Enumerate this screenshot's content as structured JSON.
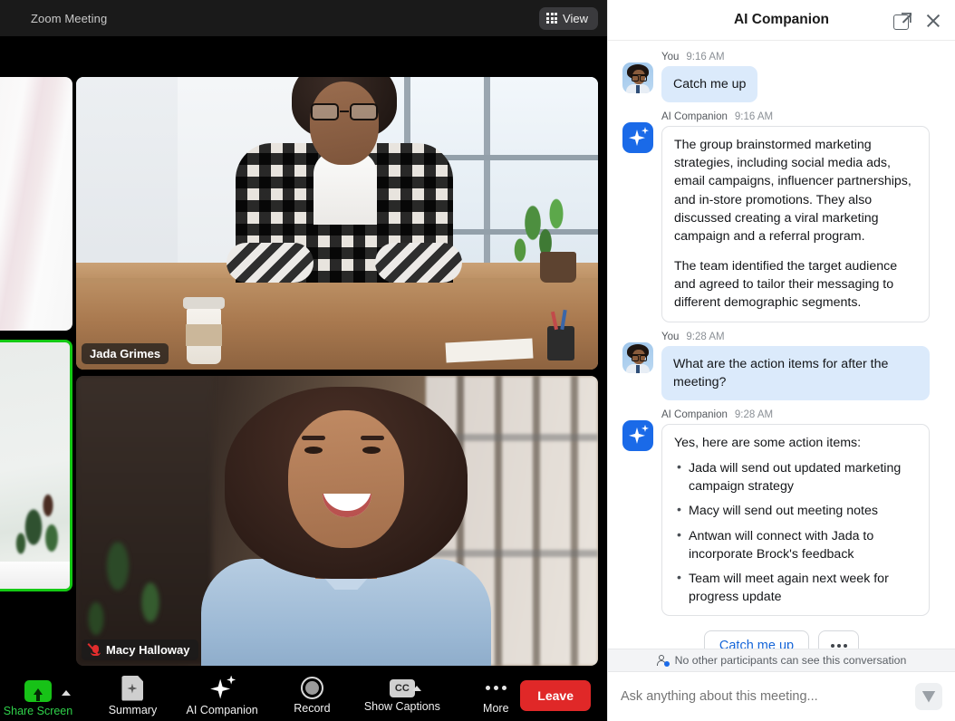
{
  "meeting": {
    "title": "Zoom Meeting",
    "view_button": {
      "label": "View",
      "icon": "grid-icon"
    },
    "participants": [
      {
        "name": "Jada Grimes",
        "muted": false
      },
      {
        "name": "Macy Halloway",
        "muted": true
      }
    ],
    "toolbar": [
      {
        "label": "Share Screen",
        "icon": "share-screen-icon",
        "has_caret": true,
        "accent": "#2fd14a"
      },
      {
        "label": "Summary",
        "icon": "summary-doc-icon",
        "has_caret": false
      },
      {
        "label": "AI Companion",
        "icon": "ai-sparkle-icon",
        "has_caret": false
      },
      {
        "label": "Record",
        "icon": "record-circle-icon",
        "has_caret": false
      },
      {
        "label": "Show Captions",
        "icon": "closed-caption-icon",
        "has_caret": true
      },
      {
        "label": "More",
        "icon": "more-dots-icon",
        "has_caret": false
      }
    ],
    "leave_button": {
      "label": "Leave",
      "color": "#e02828"
    }
  },
  "panel": {
    "title": "AI Companion",
    "header_actions": [
      {
        "name": "pop-out",
        "icon": "popout-icon"
      },
      {
        "name": "close",
        "icon": "close-icon"
      }
    ],
    "messages": [
      {
        "author": "You",
        "time": "9:16 AM",
        "type": "user",
        "paragraphs": [
          "Catch me up"
        ]
      },
      {
        "author": "AI Companion",
        "time": "9:16 AM",
        "type": "ai",
        "paragraphs": [
          "The group brainstormed marketing strategies, including social media ads, email campaigns, influencer partnerships, and in-store promotions. They also discussed creating a viral marketing campaign and a referral program.",
          "The team identified the target audience and agreed to tailor their messaging to different demographic segments."
        ]
      },
      {
        "author": "You",
        "time": "9:28 AM",
        "type": "user",
        "paragraphs": [
          "What are the action items for after the meeting?"
        ]
      },
      {
        "author": "AI Companion",
        "time": "9:28 AM",
        "type": "ai",
        "paragraphs": [
          "Yes, here are some action items:"
        ],
        "bullets": [
          "Jada will send out updated marketing campaign strategy",
          "Macy will send out meeting notes",
          "Antwan will connect with Jada to incorporate Brock's feedback",
          "Team will meet again next week for progress update"
        ]
      }
    ],
    "suggestions": [
      {
        "label": "Catch me up",
        "kind": "text"
      },
      {
        "label": "",
        "kind": "more"
      }
    ],
    "privacy_notice": "No other participants can see this conversation",
    "composer": {
      "placeholder": "Ask anything about this meeting...",
      "send_icon": "send-icon"
    }
  },
  "colors": {
    "accent_blue": "#1a6ae8",
    "link_blue": "#1565d8",
    "user_bubble": "#dbeafb",
    "leave_red": "#e02828",
    "share_green": "#2fd14a",
    "active_speaker_border": "#14c914"
  }
}
